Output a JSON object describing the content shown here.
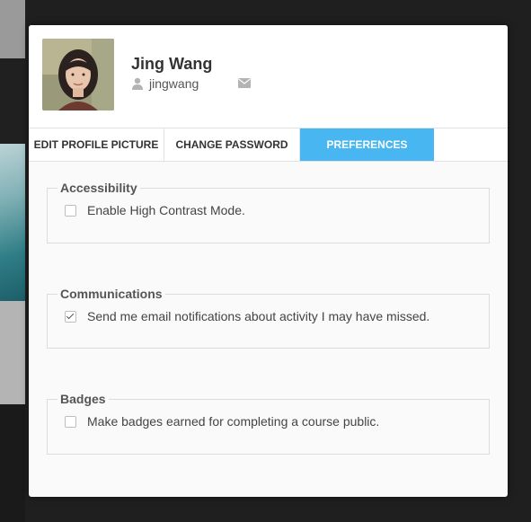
{
  "profile": {
    "name": "Jing Wang",
    "username": "jingwang"
  },
  "close_symbol": "×",
  "tabs": [
    {
      "label": "EDIT PROFILE PICTURE",
      "active": false
    },
    {
      "label": "CHANGE PASSWORD",
      "active": false
    },
    {
      "label": "PREFERENCES",
      "active": true
    }
  ],
  "sections": [
    {
      "legend": "Accessibility",
      "option": "Enable High Contrast Mode.",
      "checked": false
    },
    {
      "legend": "Communications",
      "option": "Send me email notifications about activity I may have missed.",
      "checked": true
    },
    {
      "legend": "Badges",
      "option": "Make badges earned for completing a course public.",
      "checked": false
    }
  ],
  "icons": {
    "user": "user-icon",
    "mail": "envelope-icon",
    "close": "close-icon"
  },
  "colors": {
    "accent": "#48b6f1",
    "text": "#333333"
  }
}
